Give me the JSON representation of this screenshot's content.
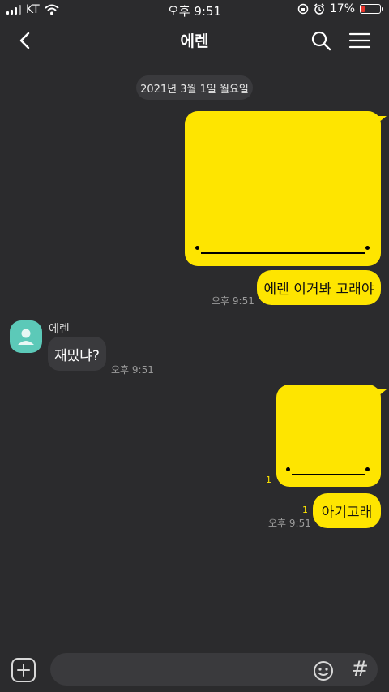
{
  "status": {
    "carrier": "KT",
    "time": "오후 9:51",
    "battery": "17%",
    "battery_level": 0.17
  },
  "header": {
    "title": "에렌"
  },
  "date_divider": "2021년 3월 1일 월요일",
  "messages": [
    {
      "type": "image",
      "direction": "out"
    },
    {
      "type": "text",
      "direction": "out",
      "text": "에렌 이거봐 고래야",
      "time": "오후 9:51"
    },
    {
      "type": "text",
      "direction": "in",
      "sender": "에렌",
      "text": "재밌냐?",
      "time": "오후 9:51"
    },
    {
      "type": "image",
      "direction": "out",
      "unread": "1"
    },
    {
      "type": "text",
      "direction": "out",
      "text": "아기고래",
      "unread": "1",
      "time": "오후 9:51"
    }
  ],
  "input": {
    "placeholder": "",
    "hash_label": "#"
  },
  "colors": {
    "background": "#2b2b2d",
    "bubble_out": "#fee500",
    "bubble_in": "#3a3a3d",
    "avatar": "#5cc9b8",
    "battery_low": "#e5332a"
  }
}
